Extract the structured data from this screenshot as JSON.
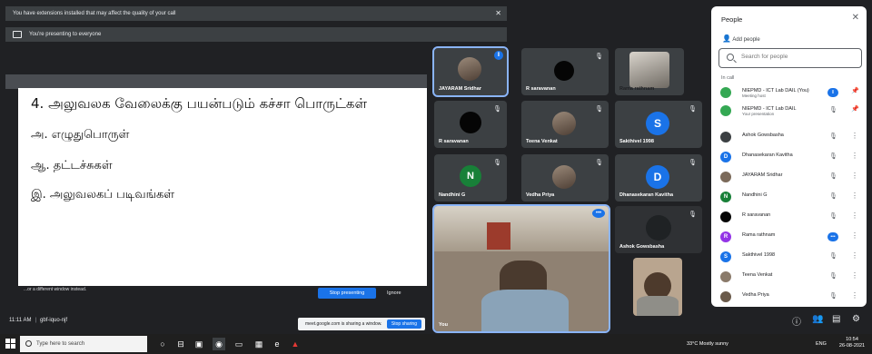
{
  "banners": {
    "extensions": "You have extensions installed that may affect the quality of your call",
    "presenting": "You're presenting to everyone"
  },
  "slide": {
    "line1": "4. அலுவலக வேலைக்கு பயன்படும் கச்சா பொருட்கள்",
    "line2": "அ. எழுதுபொருள்",
    "line3": "ஆ. தட்டச்சுகள்",
    "line4": "இ. அலுவலகப் படிவங்கள்"
  },
  "share_prompt": {
    "message": "...or a different window instead.",
    "stop_label": "Stop presenting",
    "ignore_label": "Ignore"
  },
  "meeting": {
    "time": "11:11 AM",
    "code": "gbf-iquo-njf"
  },
  "share_bar": {
    "text": "meet.google.com is sharing a window.",
    "button": "Stop sharing"
  },
  "tiles": [
    {
      "name": "JAYARAM Sridhar",
      "kind": "photo"
    },
    {
      "name": "R saravanan",
      "kind": "black"
    },
    {
      "name": "Rama rathnam",
      "kind": "photo"
    },
    {
      "name": "R saravanan",
      "kind": "black"
    },
    {
      "name": "Teena Venkat",
      "kind": "photo"
    },
    {
      "name": "Sakthivel 1998",
      "initial": "S",
      "color": "#1a73e8"
    },
    {
      "name": "Nandhini G",
      "initial": "N",
      "color": "#188038"
    },
    {
      "name": "Vedha Priya",
      "kind": "photo"
    },
    {
      "name": "Dhanasekaran Kavitha",
      "initial": "D",
      "color": "#1a73e8"
    },
    {
      "name": "You",
      "kind": "video"
    },
    {
      "name": "Ashok Gowsbasha",
      "kind": "photo"
    }
  ],
  "people_panel": {
    "title": "People",
    "add_people": "Add people",
    "search_placeholder": "Search for people",
    "in_call": "In call",
    "participants": [
      {
        "name": "NIEPMD - ICT Lab DAIL (You)",
        "sub": "Meeting host",
        "initial": "",
        "color": "#34a853"
      },
      {
        "name": "NIEPMD - ICT Lab DAIL",
        "sub": "Your presentation",
        "initial": "",
        "color": "#34a853"
      },
      {
        "name": "Ashok Gowsbasha",
        "sub": "",
        "initial": "",
        "color": "#3c4043"
      },
      {
        "name": "Dhanasekaran Kavitha",
        "sub": "",
        "initial": "D",
        "color": "#1a73e8"
      },
      {
        "name": "JAYARAM Sridhar",
        "sub": "",
        "initial": "",
        "color": "#7b6a5a"
      },
      {
        "name": "Nandhini G",
        "sub": "",
        "initial": "N",
        "color": "#188038"
      },
      {
        "name": "R saravanan",
        "sub": "",
        "initial": "",
        "color": "#050505"
      },
      {
        "name": "Rama rathnam",
        "sub": "",
        "initial": "R",
        "color": "#9334e6"
      },
      {
        "name": "Sakthivel 1998",
        "sub": "",
        "initial": "S",
        "color": "#1a73e8"
      },
      {
        "name": "Teena Venkat",
        "sub": "",
        "initial": "",
        "color": "#8a7a6a"
      },
      {
        "name": "Vedha Priya",
        "sub": "",
        "initial": "",
        "color": "#6a5a4a"
      }
    ]
  },
  "taskbar": {
    "search_placeholder": "Type here to search",
    "weather": "33°C  Mostly sunny",
    "lang": "ENG",
    "time": "10:54",
    "date": "26-08-2021"
  }
}
